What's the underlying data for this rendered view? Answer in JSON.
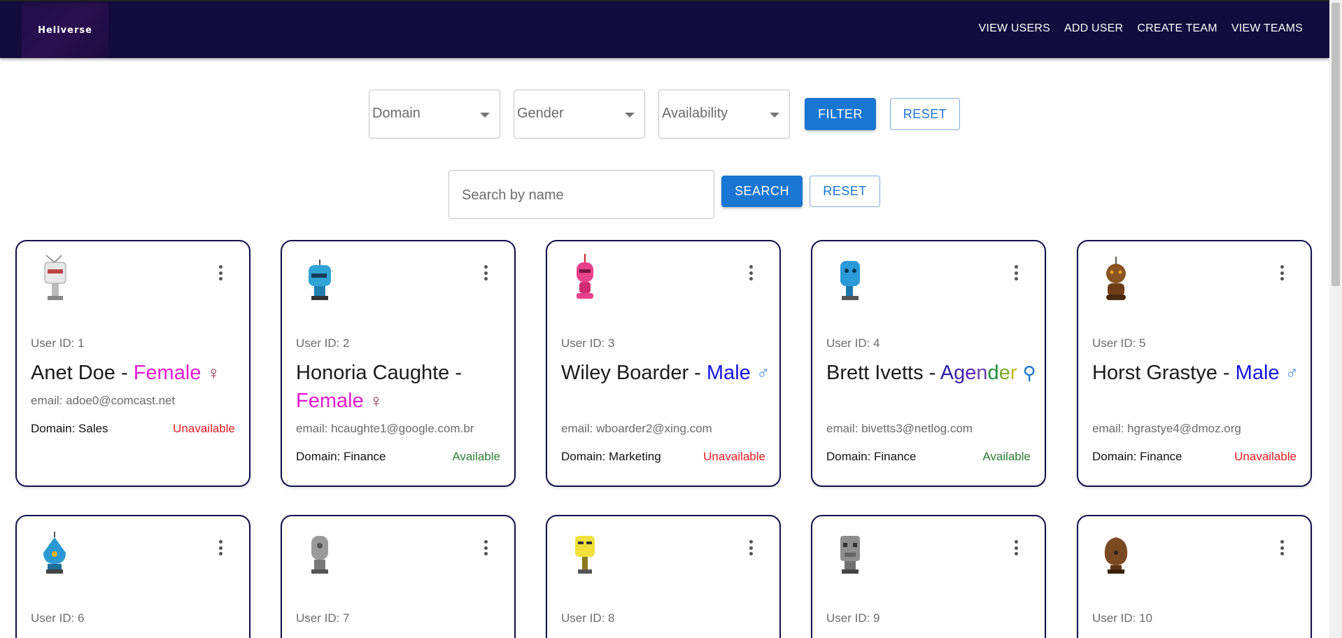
{
  "header": {
    "logo_text": "Heliverse",
    "nav": [
      "VIEW USERS",
      "ADD USER",
      "CREATE TEAM",
      "VIEW TEAMS"
    ]
  },
  "filters": {
    "domain_label": "Domain",
    "gender_label": "Gender",
    "availability_label": "Availability",
    "filter_button": "FILTER",
    "reset_button": "RESET"
  },
  "search": {
    "placeholder": "Search by name",
    "search_button": "SEARCH",
    "reset_button": "RESET"
  },
  "colors": {
    "female": "#e619d4",
    "male": "#1414e6",
    "available": "#2e7d32",
    "unavailable": "#e51c23",
    "female_symbol": "#8a2c4a",
    "male_symbol": "#4b8fe0"
  },
  "cards": [
    {
      "id_label": "User ID: 1",
      "name": "Anet Doe",
      "gender": "Female",
      "symbol": "♀",
      "email": "email: adoe0@comcast.net",
      "domain": "Domain: Sales",
      "availability": "Unavailable",
      "robot": "white"
    },
    {
      "id_label": "User ID: 2",
      "name": "Honoria Caughte",
      "gender": "Female",
      "symbol": "♀",
      "email": "email: hcaughte1@google.com.br",
      "domain": "Domain: Finance",
      "availability": "Available",
      "robot": "cyan"
    },
    {
      "id_label": "User ID: 3",
      "name": "Wiley Boarder",
      "gender": "Male",
      "symbol": "♂",
      "email": "email: wboarder2@xing.com",
      "domain": "Domain: Marketing",
      "availability": "Unavailable",
      "robot": "pink"
    },
    {
      "id_label": "User ID: 4",
      "name": "Brett Ivetts",
      "gender": "Agender",
      "symbol": "⚲",
      "email": "email: bivetts3@netlog.com",
      "domain": "Domain: Finance",
      "availability": "Available",
      "robot": "blue"
    },
    {
      "id_label": "User ID: 5",
      "name": "Horst Grastye",
      "gender": "Male",
      "symbol": "♂",
      "email": "email: hgrastye4@dmoz.org",
      "domain": "Domain: Finance",
      "availability": "Unavailable",
      "robot": "brown"
    },
    {
      "id_label": "User ID: 6",
      "robot": "cyan2"
    },
    {
      "id_label": "User ID: 7",
      "robot": "gray"
    },
    {
      "id_label": "User ID: 8",
      "robot": "yellow"
    },
    {
      "id_label": "User ID: 9",
      "robot": "gray2"
    },
    {
      "id_label": "User ID: 10",
      "robot": "brown2"
    }
  ]
}
